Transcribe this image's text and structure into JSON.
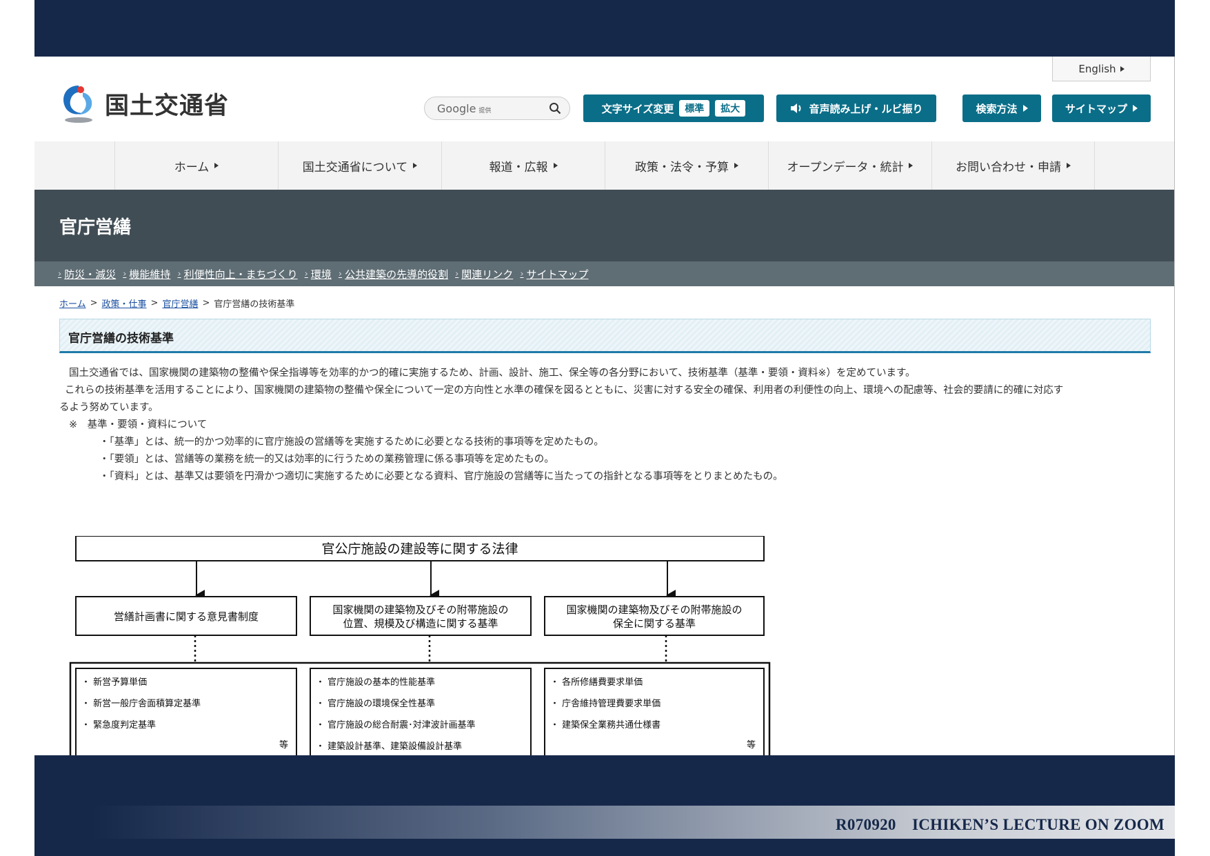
{
  "slide": {
    "caption": "R070920　ICHIKEN’S LECTURE ON ZOOM"
  },
  "header": {
    "english_label": "English",
    "logo_text": "国土交通省",
    "search": {
      "brand": "Google",
      "suffix": "提供"
    },
    "toolbar": {
      "text_size_label": "文字サイズ変更",
      "size_standard": "標準",
      "size_large": "拡大",
      "voice_label": "音声読み上げ・ルビ振り",
      "search_method_label": "検索方法",
      "sitemap_label": "サイトマップ"
    }
  },
  "nav": {
    "items": [
      {
        "label": "ホーム"
      },
      {
        "label": "国土交通省について"
      },
      {
        "label": "報道・広報"
      },
      {
        "label": "政策・法令・予算"
      },
      {
        "label": "オープンデータ・統計"
      },
      {
        "label": "お問い合わせ・申請"
      }
    ]
  },
  "section": {
    "title": "官庁営繕",
    "subnav": [
      {
        "label": "防災・減災"
      },
      {
        "label": "機能維持"
      },
      {
        "label": "利便性向上・まちづくり"
      },
      {
        "label": "環境"
      },
      {
        "label": "公共建築の先導的役割"
      },
      {
        "label": "関連リンク"
      },
      {
        "label": "サイトマップ"
      }
    ]
  },
  "breadcrumb": {
    "home": "ホーム",
    "policy": "政策・仕事",
    "eizen": "官庁営繕",
    "current": "官庁営繕の技術基準",
    "sep": ">"
  },
  "content": {
    "heading": "官庁営繕の技術基準",
    "para1": "国土交通省では、国家機関の建築物の整備や保全指導等を効率的かつ的確に実施するため、計画、設計、施工、保全等の各分野において、技術基準（基準・要領・資料※）を定めています。",
    "para2a": "これらの技術基準を活用することにより、国家機関の建築物の整備や保全について一定の方向性と水準の確保を図るとともに、災害に対する安全の確保、利用者の利便性の向上、環境への配慮等、社会的要請に的確に対応す",
    "para2b": "るよう努めています。",
    "note_title": "※　基準・要領・資料について",
    "bullets": [
      "・「基準」とは、統一的かつ効率的に官庁施設の営繕等を実施するために必要となる技術的事項等を定めたもの。",
      "・「要領」とは、営繕等の業務を統一的又は効率的に行うための業務管理に係る事項等を定めたもの。",
      "・「資料」とは、基準又は要領を円滑かつ適切に実施するために必要となる資料、官庁施設の営繕等に当たっての指針となる事項等をとりまとめたもの。"
    ]
  },
  "diagram": {
    "law": "官公庁施設の建設等に関する法律",
    "col1": {
      "title": "営繕計画書に関する意見書制度",
      "items": [
        "・ 新営予算単価",
        "・ 新営一般庁舎面積算定基準",
        "・ 緊急度判定基準"
      ],
      "etc": "等"
    },
    "col2": {
      "title1": "国家機関の建築物及びその附帯施設の",
      "title2": "位置、規模及び構造に関する基準",
      "items": [
        "・ 官庁施設の基本的性能基準",
        "・ 官庁施設の環境保全性基準",
        "・ 官庁施設の総合耐震･対津波計画基準",
        "・ 建築設計基準、建築設備設計基準"
      ]
    },
    "col3": {
      "title1": "国家機関の建築物及びその附帯施設の",
      "title2": "保全に関する基準",
      "items": [
        "・ 各所修繕費要求単価",
        "・ 庁舎維持管理費要求単価",
        "・ 建築保全業務共通仕様書"
      ],
      "etc": "等"
    }
  }
}
